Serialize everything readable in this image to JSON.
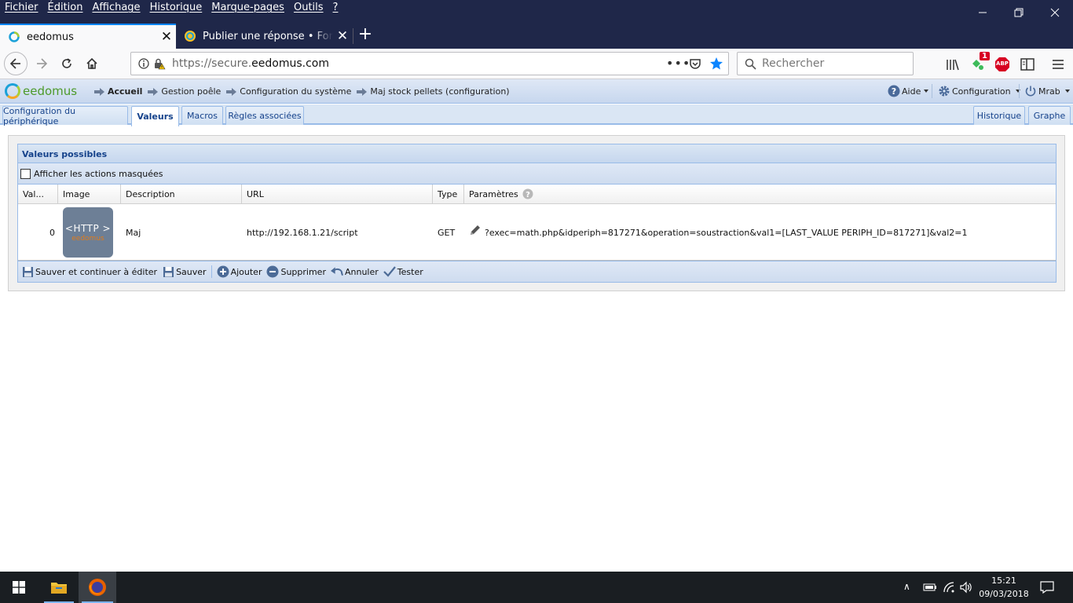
{
  "browser": {
    "menu": [
      "Fichier",
      "Édition",
      "Affichage",
      "Historique",
      "Marque-pages",
      "Outils",
      "?"
    ],
    "tabs": [
      {
        "title": "eedomus",
        "active": true
      },
      {
        "title": "Publier une réponse • Forum eedomus",
        "active": false
      }
    ],
    "url": {
      "prefix": "https://secure.",
      "domain": "eedomus.com"
    },
    "search_placeholder": "Rechercher",
    "notification_badge": "1",
    "abp_label": "ABP"
  },
  "app": {
    "logo_text": "eedomus",
    "breadcrumb": [
      "Accueil",
      "Gestion poêle",
      "Configuration du système",
      "Maj stock pellets (configuration)"
    ],
    "header_right": {
      "help": "Aide",
      "config": "Configuration",
      "user": "Mrab"
    },
    "tabs": [
      "Configuration du périphérique",
      "Valeurs",
      "Macros",
      "Règles associées"
    ],
    "active_tab": "Valeurs",
    "right_tabs": [
      "Historique",
      "Graphe"
    ]
  },
  "panel": {
    "title": "Valeurs possibles",
    "show_hidden_label": "Afficher les actions masquées",
    "columns": [
      "Val...",
      "Image",
      "Description",
      "URL",
      "Type",
      "Paramètres"
    ],
    "rows": [
      {
        "value": "0",
        "image": {
          "line1": "<HTTP >",
          "line2": "eedomus"
        },
        "description": "Maj",
        "url": "http://192.168.1.21/script",
        "type": "GET",
        "params": "?exec=math.php&idperiph=817271&operation=soustraction&val1=[LAST_VALUE PERIPH_ID=817271]&val2=1"
      }
    ],
    "actions": [
      "Sauver et continuer à éditer",
      "Sauver",
      "Ajouter",
      "Supprimer",
      "Annuler",
      "Tester"
    ]
  },
  "taskbar": {
    "time": "15:21",
    "date": "09/03/2018"
  },
  "colors": {
    "window_dark": "#1f2749",
    "accent_blue": "#0a84ff",
    "ext_header": "#c7d7ee",
    "ext_title": "#15428b"
  }
}
